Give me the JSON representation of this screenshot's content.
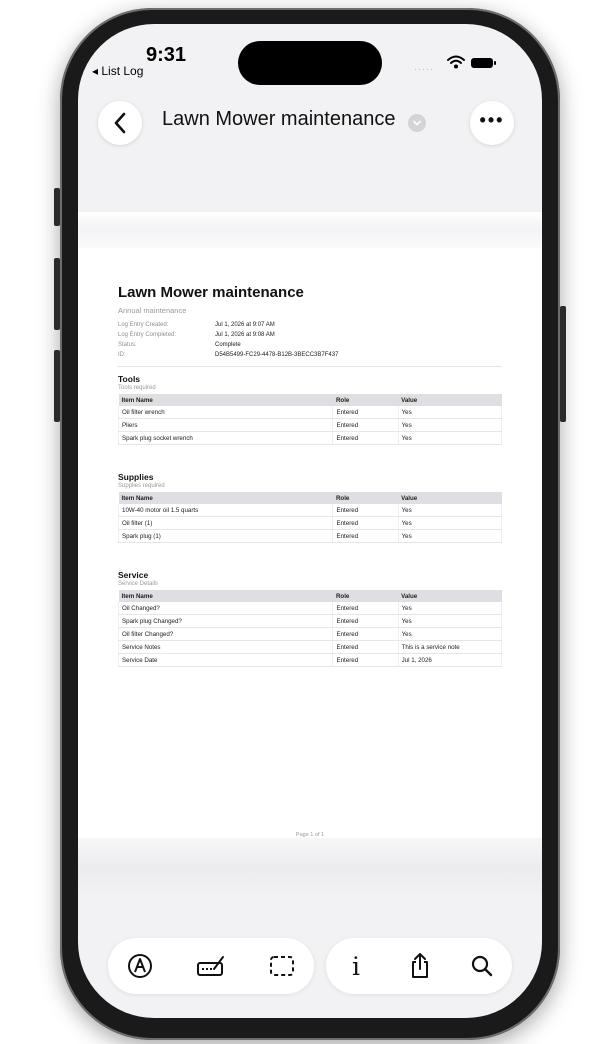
{
  "status_bar": {
    "time": "9:31",
    "back_app": "◂ List Log",
    "signal": "·····"
  },
  "nav": {
    "title": "Lawn Mower maintenance",
    "icons": {
      "back": "chevron-left-icon",
      "title_menu": "chevron-down-icon",
      "more": "ellipsis-icon"
    }
  },
  "document": {
    "title": "Lawn Mower maintenance",
    "subtitle": "Annual maintenance",
    "meta": [
      {
        "label": "Log Entry Created:",
        "value": "Jul 1, 2026 at 9:07 AM"
      },
      {
        "label": "Log Entry Completed:",
        "value": "Jul 1, 2026 at 9:08 AM"
      },
      {
        "label": "Status:",
        "value": "Complete"
      },
      {
        "label": "ID:",
        "value": "D54B5499-FC29-4478-B12B-3BECC3B7F437"
      }
    ],
    "columns": [
      "Item Name",
      "Role",
      "Value"
    ],
    "sections": [
      {
        "title": "Tools",
        "subtitle": "Tools required",
        "rows": [
          [
            "Oil filter wrench",
            "Entered",
            "Yes"
          ],
          [
            "Pliers",
            "Entered",
            "Yes"
          ],
          [
            "Spark plug socket wrench",
            "Entered",
            "Yes"
          ]
        ]
      },
      {
        "title": "Supplies",
        "subtitle": "Supplies required",
        "rows": [
          [
            "10W-40 motor oil 1.5 quarts",
            "Entered",
            "Yes"
          ],
          [
            "Oil filter (1)",
            "Entered",
            "Yes"
          ],
          [
            "Spark plug (1)",
            "Entered",
            "Yes"
          ]
        ]
      },
      {
        "title": "Service",
        "subtitle": "Service Details",
        "rows": [
          [
            "Oil Changed?",
            "Entered",
            "Yes"
          ],
          [
            "Spark plug Changed?",
            "Entered",
            "Yes"
          ],
          [
            "Oil filter Changed?",
            "Entered",
            "Yes"
          ],
          [
            "Service Notes",
            "Entered",
            "This is a service note"
          ],
          [
            "Service Date",
            "Entered",
            "Jul 1, 2026"
          ]
        ]
      }
    ],
    "page_label": "Page 1 of 1"
  },
  "toolbar": {
    "info_glyph": "i",
    "icons": [
      "markup-icon",
      "signature-icon",
      "selection-icon",
      "info-icon",
      "share-icon",
      "search-icon"
    ]
  }
}
